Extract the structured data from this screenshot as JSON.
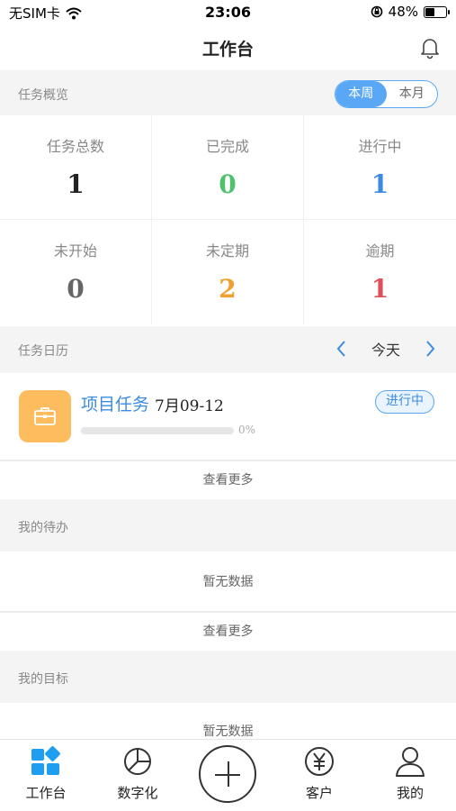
{
  "status_bar": {
    "carrier": "无SIM卡",
    "time": "23:06",
    "battery_text": "48%",
    "battery_level": 0.48
  },
  "nav": {
    "title": "工作台"
  },
  "overview": {
    "label": "任务概览",
    "segments": [
      "本周",
      "本月"
    ],
    "active_segment": 0,
    "stats": [
      {
        "label": "任务总数",
        "value": "1",
        "color": "#222222"
      },
      {
        "label": "已完成",
        "value": "0",
        "color": "#4cc36a"
      },
      {
        "label": "进行中",
        "value": "1",
        "color": "#3d8be0"
      },
      {
        "label": "未开始",
        "value": "0",
        "color": "#666666"
      },
      {
        "label": "未定期",
        "value": "2",
        "color": "#f0a030"
      },
      {
        "label": "逾期",
        "value": "1",
        "color": "#e0505a"
      }
    ]
  },
  "calendar": {
    "label": "任务日历",
    "today_label": "今天",
    "task": {
      "title": "项目任务",
      "date": "7月09-12",
      "progress": 0,
      "progress_text": "0%",
      "status": "进行中",
      "icon": "briefcase-icon"
    },
    "more": "查看更多"
  },
  "todo": {
    "label": "我的待办",
    "empty": "暂无数据",
    "more": "查看更多"
  },
  "goals": {
    "label": "我的目标",
    "empty": "暂无数据"
  },
  "tabs": [
    {
      "label": "工作台",
      "icon": "dashboard-icon",
      "active": true
    },
    {
      "label": "数字化",
      "icon": "pie-chart-icon",
      "active": false
    },
    {
      "label": "",
      "icon": "add-icon",
      "active": false
    },
    {
      "label": "客户",
      "icon": "yuan-icon",
      "active": false
    },
    {
      "label": "我的",
      "icon": "user-icon",
      "active": false
    }
  ],
  "colors": {
    "accent": "#5aa8f5",
    "task_icon_bg": "#fdbd5f",
    "tab_active": "#1e9ef0"
  }
}
